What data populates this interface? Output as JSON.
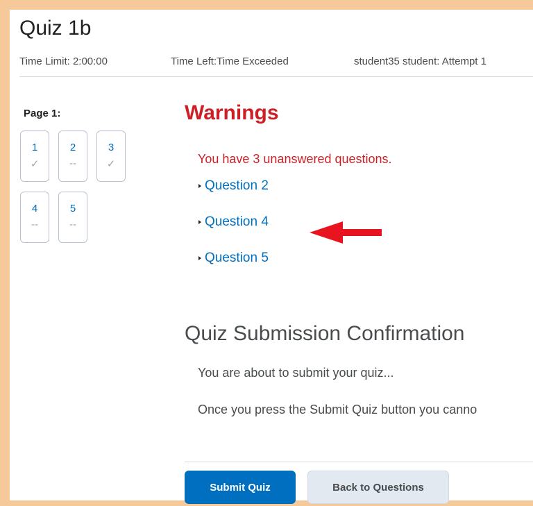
{
  "quiz": {
    "title": "Quiz 1b",
    "time_limit": "Time Limit: 2:00:00",
    "time_left": "Time Left:Time Exceeded",
    "attempt": "student35 student: Attempt 1"
  },
  "sidebar": {
    "page_label": "Page 1:",
    "questions": [
      {
        "number": "1",
        "status": "✓"
      },
      {
        "number": "2",
        "status": "--"
      },
      {
        "number": "3",
        "status": "✓"
      },
      {
        "number": "4",
        "status": "--"
      },
      {
        "number": "5",
        "status": "--"
      }
    ]
  },
  "warnings": {
    "heading": "Warnings",
    "message": "You have 3 unanswered questions.",
    "links": [
      "Question 2",
      "Question 4",
      "Question 5"
    ]
  },
  "confirmation": {
    "heading": "Quiz Submission Confirmation",
    "text1": "You are about to submit your quiz...",
    "text2": "Once you press the Submit Quiz button you canno"
  },
  "buttons": {
    "submit": "Submit Quiz",
    "back": "Back to Questions"
  },
  "colors": {
    "accent": "#006fbf",
    "warning": "#cd2026",
    "frame": "#f6c99b",
    "arrow": "#e8141f"
  },
  "annotation": {
    "arrow_icon": "red-arrow-left-icon"
  }
}
